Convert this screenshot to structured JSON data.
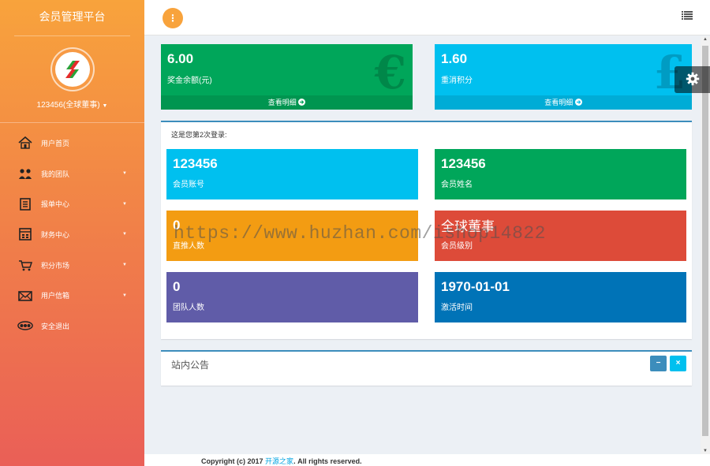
{
  "sidebar": {
    "brand": "会员管理平台",
    "user_name": "123456(全球董事)",
    "items": [
      {
        "label": "用户首页",
        "icon": "home-icon",
        "caret": false
      },
      {
        "label": "我的团队",
        "icon": "team-icon",
        "caret": true
      },
      {
        "label": "报单中心",
        "icon": "order-icon",
        "caret": true
      },
      {
        "label": "财务中心",
        "icon": "finance-icon",
        "caret": true
      },
      {
        "label": "积分市场",
        "icon": "market-icon",
        "caret": true
      },
      {
        "label": "用户信箱",
        "icon": "mail-icon",
        "caret": true
      },
      {
        "label": "安全退出",
        "icon": "logout-icon",
        "caret": false
      }
    ]
  },
  "header": {
    "toggle_icon": "more-vertical-icon",
    "menu_icon": "list-icon"
  },
  "stats": [
    {
      "value": "6.00",
      "label": "奖金余额(元)",
      "footer": "查看明细",
      "symbol": "€",
      "color": "#00a65a"
    },
    {
      "value": "1.60",
      "label": "重消积分",
      "footer": "查看明细",
      "symbol": "£",
      "color": "#00c0ef"
    }
  ],
  "info": {
    "login_text": "这是您第2次登录:",
    "boxes": [
      {
        "value": "123456",
        "label": "会员账号",
        "color": "#00c0ef"
      },
      {
        "value": "123456",
        "label": "会员姓名",
        "color": "#00a65a"
      },
      {
        "value": "0",
        "label": "直推人数",
        "color": "#f39c12"
      },
      {
        "value": "全球董事",
        "label": "会员级别",
        "color": "#dd4b39"
      },
      {
        "value": "0",
        "label": "团队人数",
        "color": "#605ca8"
      },
      {
        "value": "1970-01-01",
        "label": "激活时间",
        "color": "#0073b7"
      }
    ]
  },
  "notice": {
    "title": "站内公告",
    "min_label": "−",
    "close_label": "×"
  },
  "watermark": "https://www.huzhan.com/ishop14822",
  "footer": {
    "prefix": "Copyright (c) 2017",
    "link": "开源之家",
    "suffix": ". All rights reserved."
  }
}
